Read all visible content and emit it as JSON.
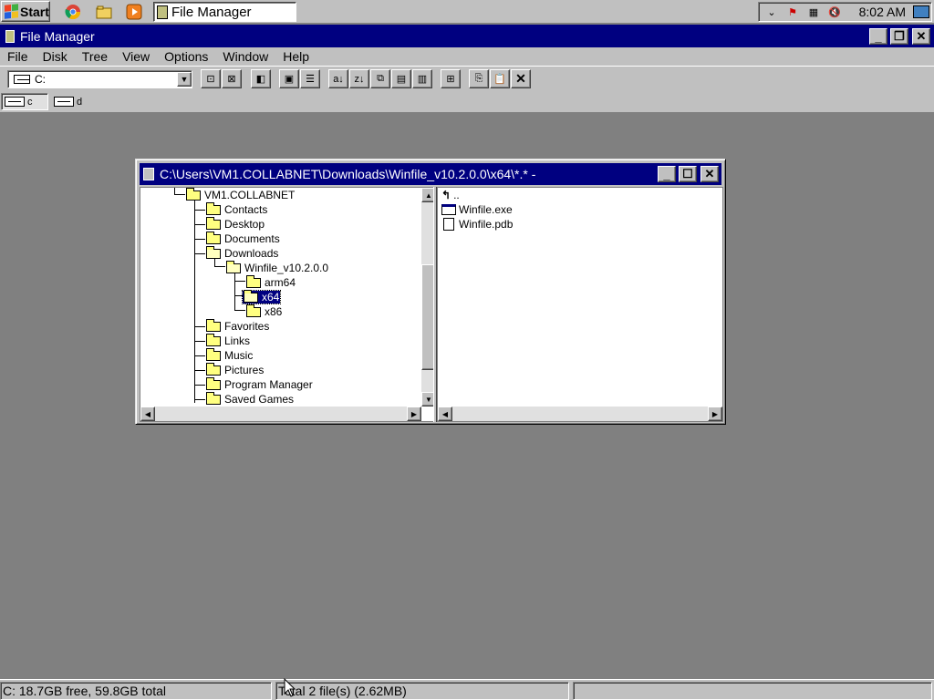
{
  "taskbar": {
    "start_label": "Start",
    "quick_launch": [
      "chrome-icon",
      "explorer-icon",
      "media-player-icon"
    ],
    "active_task": "File Manager",
    "clock": "8:02 AM"
  },
  "app": {
    "title": "File Manager",
    "menu": [
      "File",
      "Disk",
      "Tree",
      "View",
      "Options",
      "Window",
      "Help"
    ],
    "drive_select": "C:",
    "drives": [
      {
        "letter": "c"
      },
      {
        "letter": "d"
      }
    ]
  },
  "child": {
    "title": "C:\\Users\\VM1.COLLABNET\\Downloads\\Winfile_v10.2.0.0\\x64\\*.* -",
    "tree": [
      {
        "label": "VM1.COLLABNET",
        "depth": 0
      },
      {
        "label": "Contacts",
        "depth": 1
      },
      {
        "label": "Desktop",
        "depth": 1
      },
      {
        "label": "Documents",
        "depth": 1
      },
      {
        "label": "Downloads",
        "depth": 1
      },
      {
        "label": "Winfile_v10.2.0.0",
        "depth": 2
      },
      {
        "label": "arm64",
        "depth": 3
      },
      {
        "label": "x64",
        "depth": 3,
        "selected": true
      },
      {
        "label": "x86",
        "depth": 3
      },
      {
        "label": "Favorites",
        "depth": 1
      },
      {
        "label": "Links",
        "depth": 1
      },
      {
        "label": "Music",
        "depth": 1
      },
      {
        "label": "Pictures",
        "depth": 1
      },
      {
        "label": "Program Manager",
        "depth": 1
      },
      {
        "label": "Saved Games",
        "depth": 1
      }
    ],
    "files": [
      {
        "name": "..",
        "type": "up"
      },
      {
        "name": "Winfile.exe",
        "type": "exe"
      },
      {
        "name": "Winfile.pdb",
        "type": "doc"
      }
    ]
  },
  "status": {
    "disk": "C: 18.7GB free,  59.8GB total",
    "files": "Total 2 file(s) (2.62MB)",
    "extra": ""
  },
  "colors": {
    "title_active": "#000080",
    "desktop": "#808080",
    "face": "#c0c0c0"
  }
}
